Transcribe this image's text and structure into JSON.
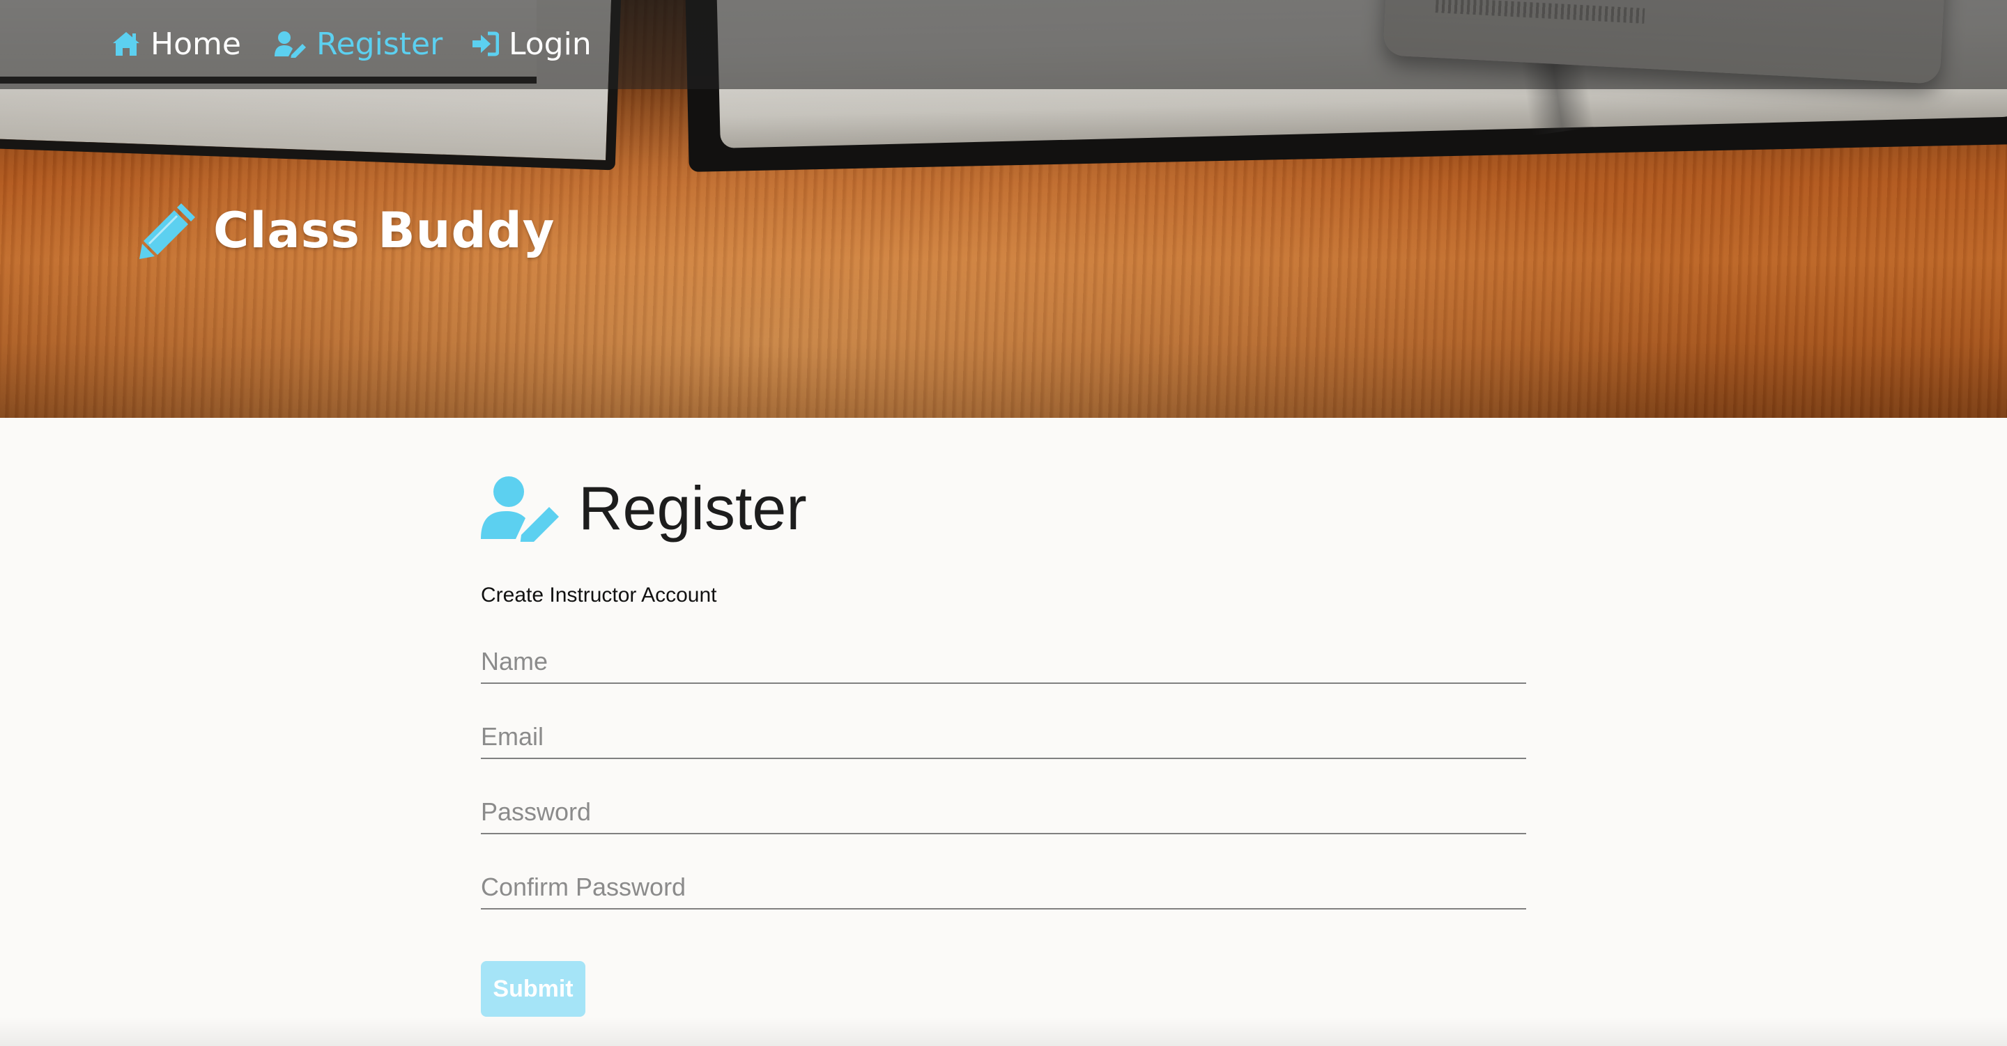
{
  "nav": {
    "items": [
      {
        "label": "Home",
        "icon": "home-icon",
        "active": false
      },
      {
        "label": "Register",
        "icon": "user-edit-icon",
        "active": true
      },
      {
        "label": "Login",
        "icon": "sign-in-icon",
        "active": false
      }
    ]
  },
  "brand": {
    "title": "Class Buddy",
    "icon": "pencil-icon"
  },
  "form": {
    "title": "Register",
    "icon": "user-edit-icon",
    "subtitle": "Create Instructor Account",
    "fields": {
      "name_placeholder": "Name",
      "email_placeholder": "Email",
      "password_placeholder": "Password",
      "confirm_placeholder": "Confirm Password"
    },
    "submit_label": "Submit"
  },
  "colors": {
    "accent": "#5cd0f0",
    "submit_bg": "#a5e4f7",
    "page_bg": "#fbfaf8",
    "heading_text": "#1d1d1d"
  }
}
